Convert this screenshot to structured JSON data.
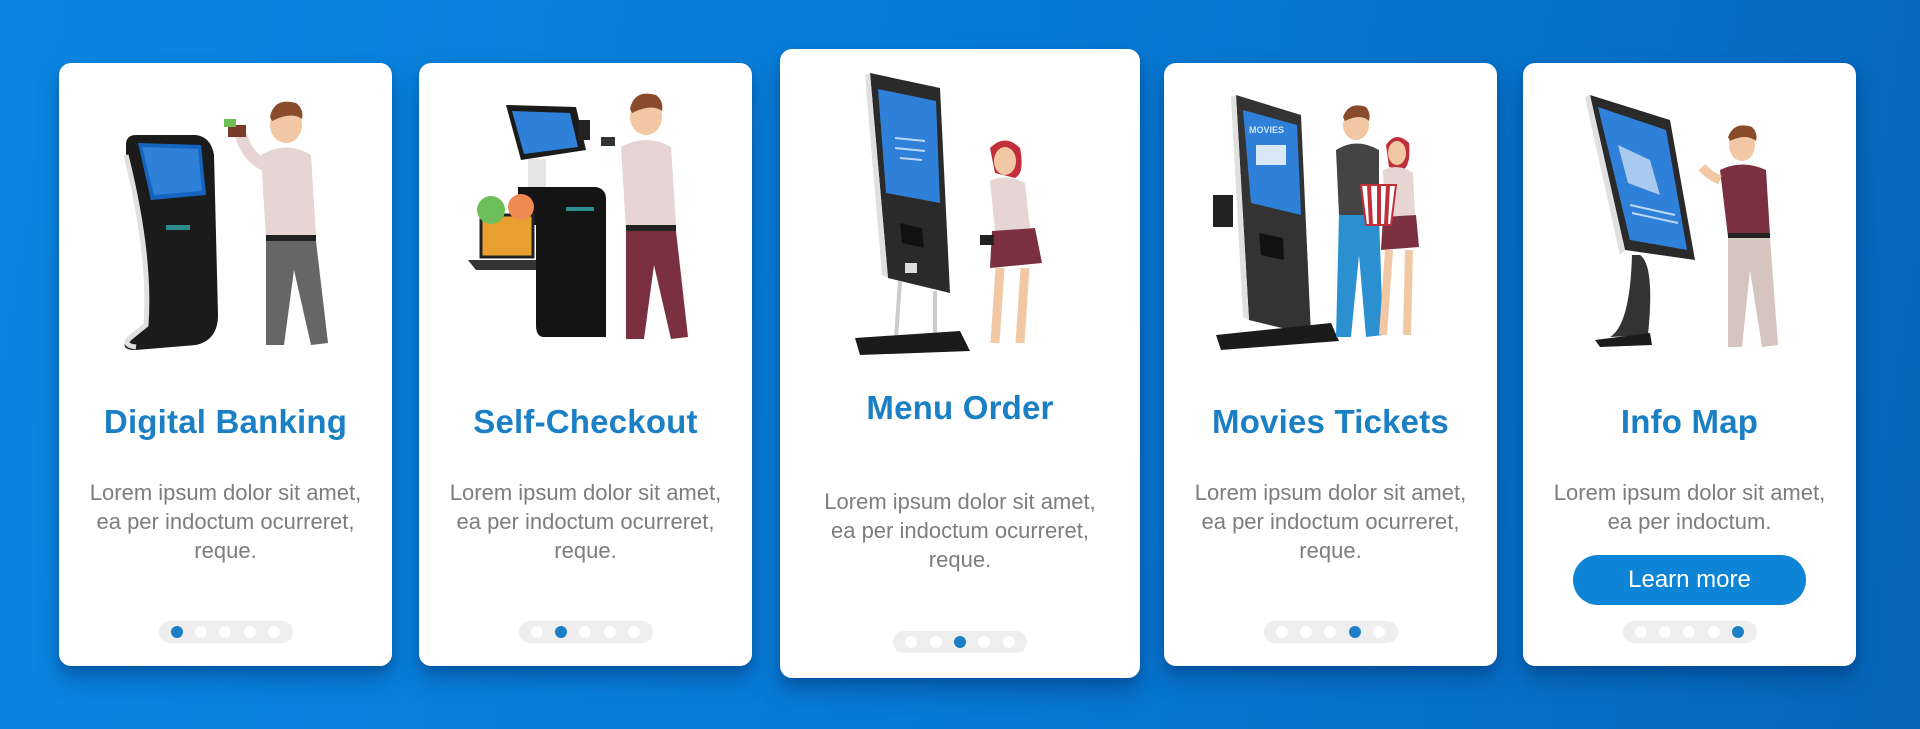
{
  "colors": {
    "background": "#087bd6",
    "card": "#ffffff",
    "title": "#1a7fc4",
    "body_text": "#7d7d7d",
    "dot_active": "#1a7fc4",
    "dot_inactive": "#ffffff",
    "dot_track": "#eeeeee",
    "button": "#0d84d6",
    "button_text": "#ffffff"
  },
  "cards": [
    {
      "illustration": "banking-kiosk-man-with-wallet",
      "title": "Digital Banking",
      "description": "Lorem ipsum dolor sit amet, ea per indoctum ocurreret, reque.",
      "active_dot": 1,
      "total_dots": 5
    },
    {
      "illustration": "self-checkout-kiosk-man-with-card",
      "title": "Self-Checkout",
      "description": "Lorem ipsum dolor sit amet, ea per indoctum ocurreret, reque.",
      "active_dot": 2,
      "total_dots": 5
    },
    {
      "illustration": "menu-order-kiosk-woman",
      "title": "Menu Order",
      "description": "Lorem ipsum dolor sit amet, ea per indoctum ocurreret, reque.",
      "active_dot": 3,
      "total_dots": 5
    },
    {
      "illustration": "movie-ticket-kiosk-couple-with-popcorn",
      "title": "Movies Tickets",
      "description": "Lorem ipsum dolor sit amet, ea per indoctum ocurreret, reque.",
      "screen_label": "MOVIES",
      "active_dot": 4,
      "total_dots": 5
    },
    {
      "illustration": "info-map-kiosk-man",
      "title": "Info Map",
      "description": "Lorem ipsum dolor sit amet, ea per indoctum.",
      "button_label": "Learn more",
      "active_dot": 5,
      "total_dots": 5
    }
  ]
}
